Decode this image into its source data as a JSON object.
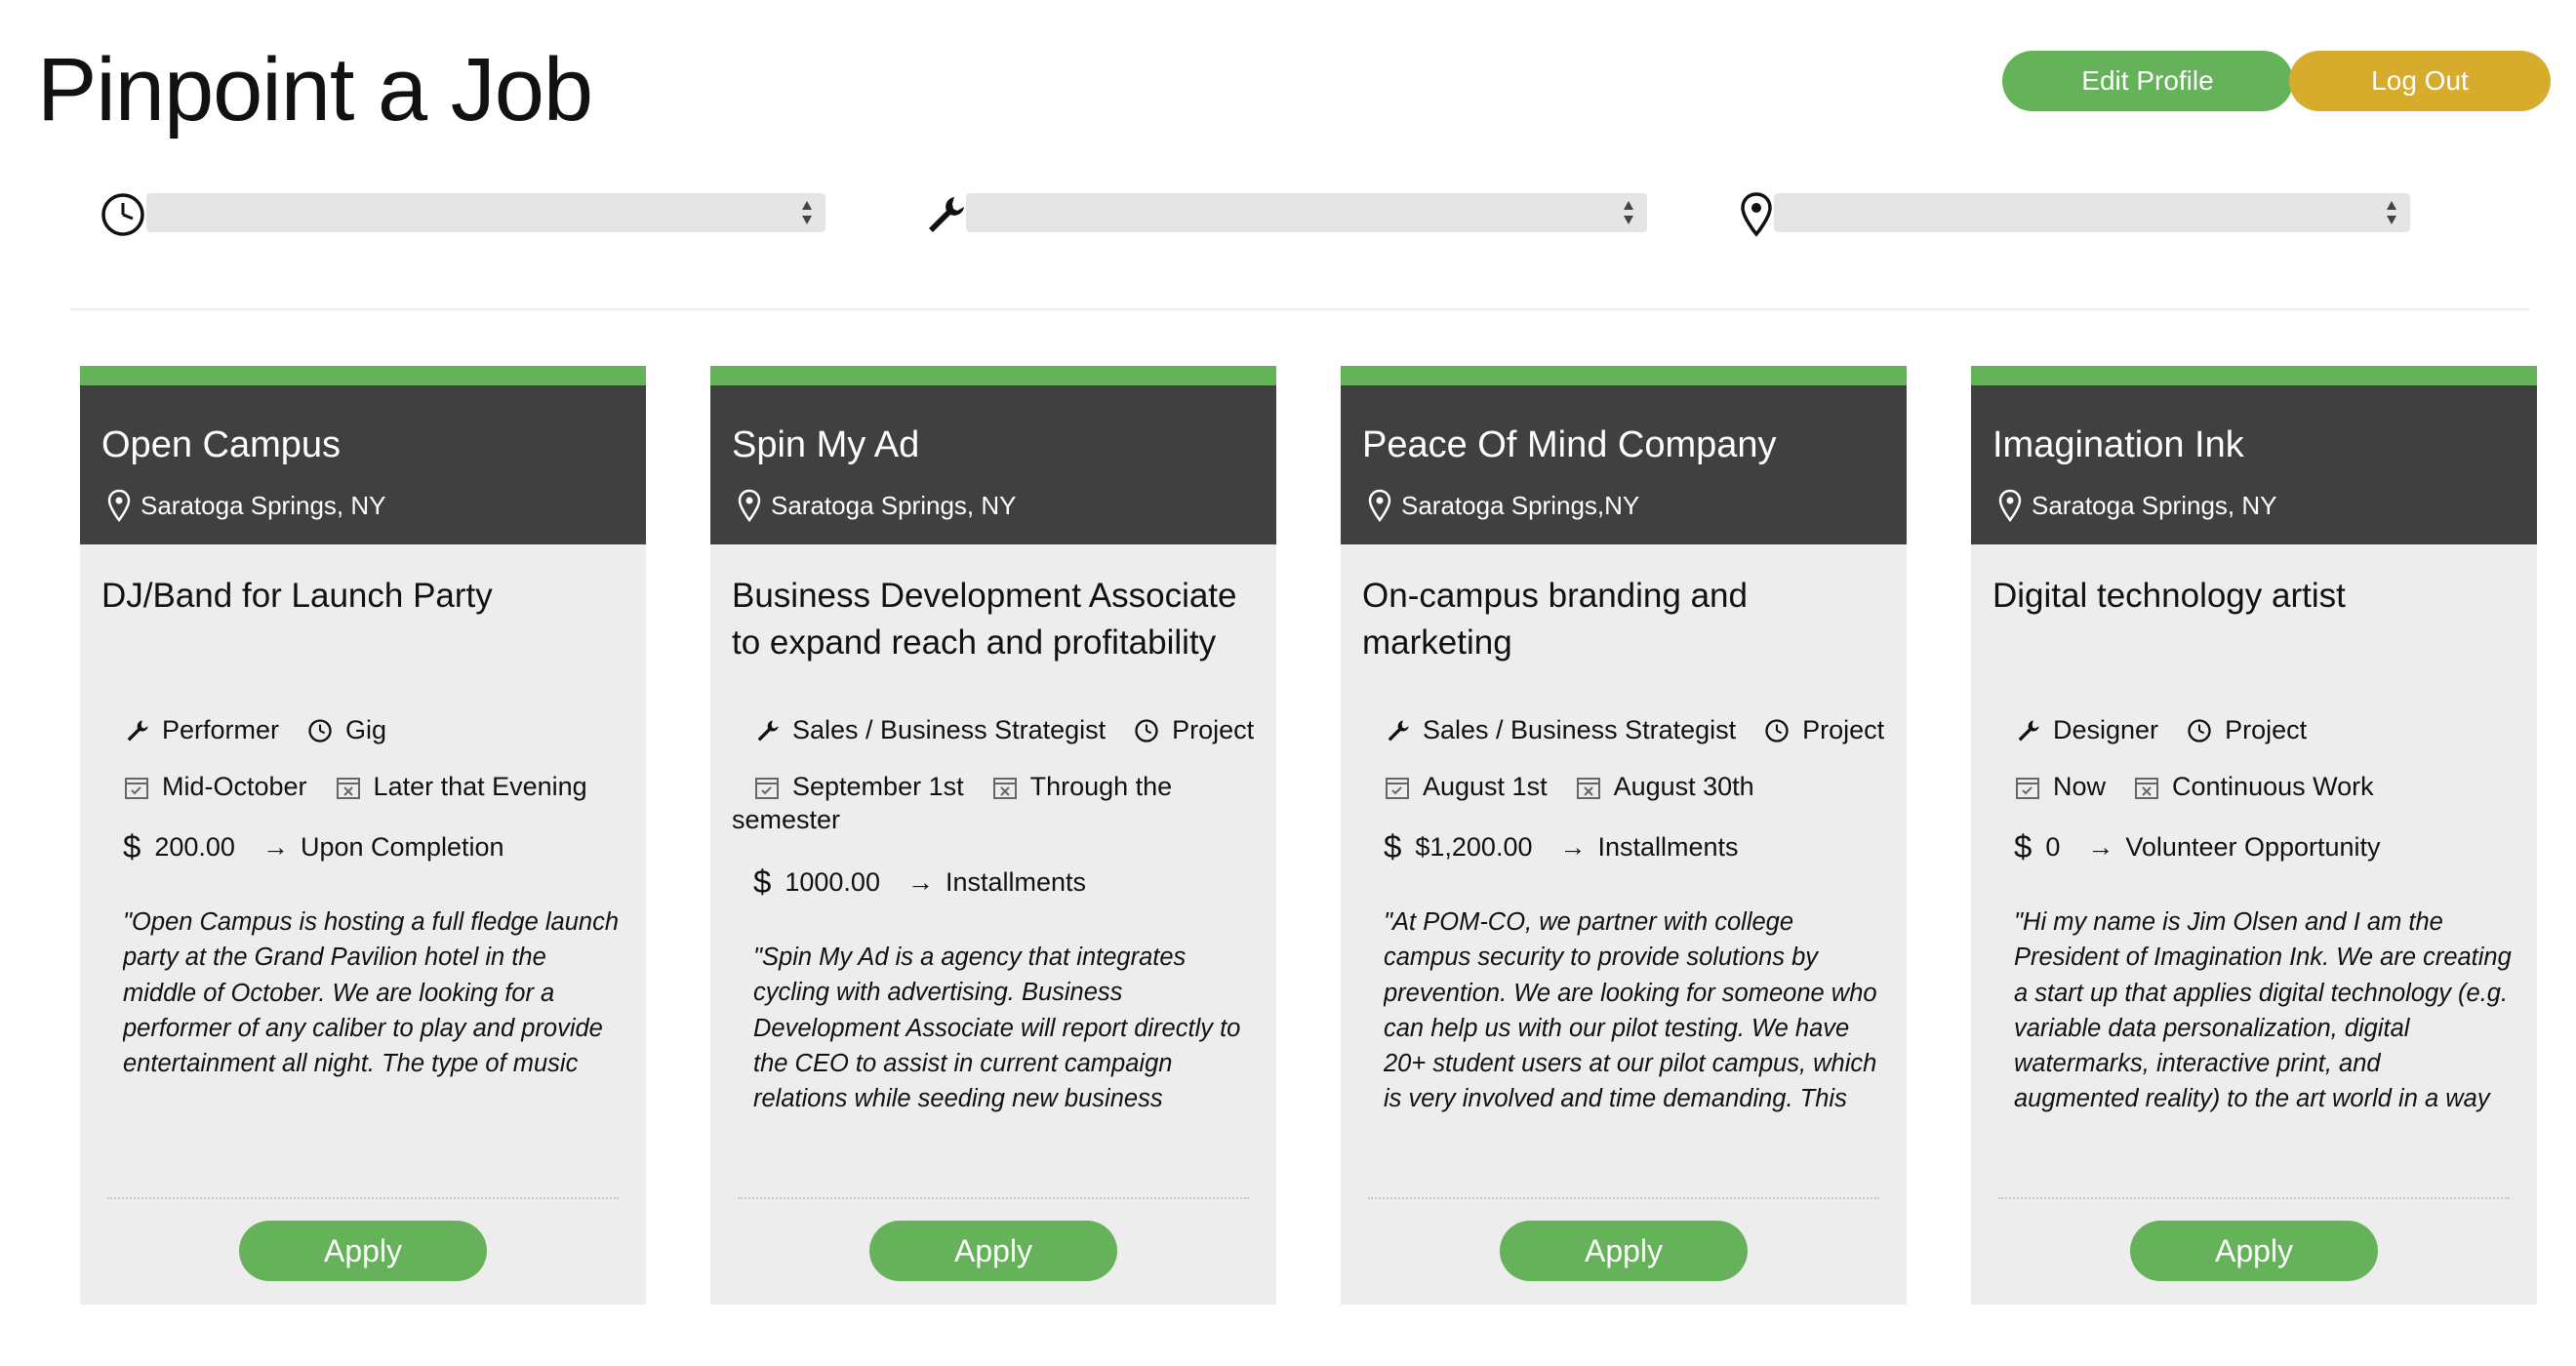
{
  "header": {
    "title": "Pinpoint a Job",
    "edit_profile_label": "Edit Profile",
    "logout_label": "Log Out"
  },
  "filters": [
    {
      "icon": "clock-icon",
      "value": ""
    },
    {
      "icon": "wrench-icon",
      "value": ""
    },
    {
      "icon": "location-pin-icon",
      "value": ""
    }
  ],
  "colors": {
    "accent_green": "#66b25a",
    "logout_gold": "#d7ac2c",
    "card_header": "#404040",
    "card_body": "#ededed"
  },
  "cards": [
    {
      "company": "Open Campus",
      "location": "Saratoga Springs, NY",
      "job_title": "DJ/Band for Launch Party",
      "role": "Performer",
      "type": "Gig",
      "start": "Mid-October",
      "end": "Later that Evening",
      "pay": "200.00",
      "pay_terms": "Upon Completion",
      "description": "\"Open Campus is hosting a full fledge launch party at the Grand Pavilion hotel in the middle of October. We are looking for a performer of any caliber to play and provide entertainment all night. The type of music has not been specified, so anyone can apply!\"",
      "apply_label": "Apply"
    },
    {
      "company": "Spin My Ad",
      "location": "Saratoga Springs, NY",
      "job_title": "Business Development Associate to expand reach and profitability",
      "role": "Sales / Business Strategist",
      "type": "Project",
      "start": "September 1st",
      "end": "Through the",
      "end_cont": "semester",
      "pay": "1000.00",
      "pay_terms": "Installments",
      "description": "\"Spin My Ad is a agency that integrates cycling with advertising. Business Development Associate will report directly to the CEO to assist in current campaign relations while seeding new business relationships and opportunities.\"",
      "apply_label": "Apply"
    },
    {
      "company": "Peace Of Mind Company",
      "location": "Saratoga Springs,NY",
      "job_title": "On-campus branding and marketing",
      "role": "Sales / Business Strategist",
      "type": "Project",
      "start": "August 1st",
      "end": "August 30th",
      "pay": "$1,200.00",
      "pay_terms": "Installments",
      "description": "\"At POM-CO, we partner with college campus security to provide solutions by prevention. We are looking for someone who can help us with our pilot testing. We have 20+ student users at our pilot campus, which is very involved and time demanding. This person would be responsible for",
      "apply_label": "Apply"
    },
    {
      "company": "Imagination Ink",
      "location": "Saratoga Springs, NY",
      "job_title": "Digital technology artist",
      "role": "Designer",
      "type": "Project",
      "start": "Now",
      "end": "Continuous Work",
      "pay": "0",
      "pay_terms": "Volunteer Opportunity",
      "description": "\"Hi my name is Jim Olsen and I am the President of Imagination Ink. We are creating a start up that applies digital technology (e.g. variable data personalization, digital watermarks, interactive print, and augmented reality) to the art world in a way that hasn't been",
      "apply_label": "Apply"
    }
  ]
}
